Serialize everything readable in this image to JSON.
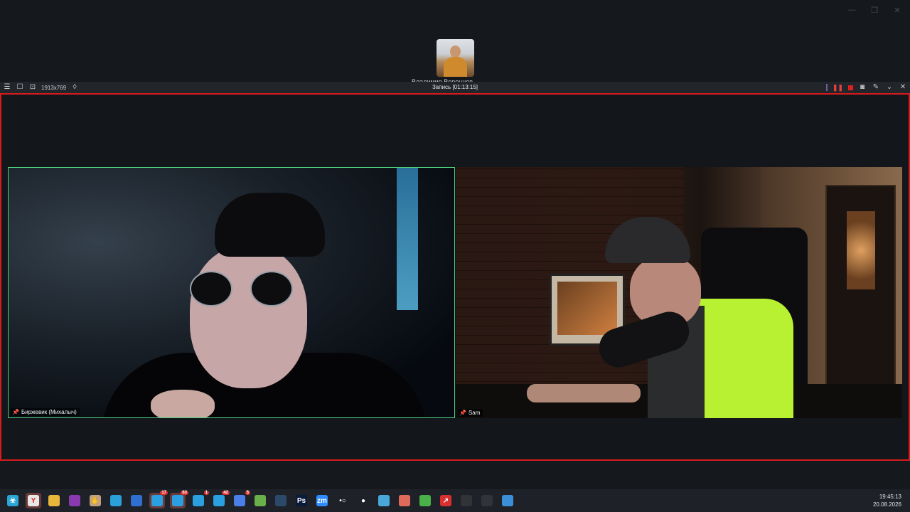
{
  "window": {
    "minimize_icon": "minimize-icon",
    "maximize_icon": "maximize-icon",
    "close_icon": "close-icon"
  },
  "thumbnail": {
    "label": "Владимир Воронцов"
  },
  "toolbar": {
    "resolution": "1913x769",
    "title": "Запись [01:13:15]",
    "icons": [
      "menu-icon",
      "square-icon",
      "zoom-icon",
      "drop-icon",
      "pause-icon",
      "stop-icon",
      "camera-icon",
      "pen-icon",
      "collapse-icon",
      "close-icon"
    ]
  },
  "colors": {
    "accent_border": "#d51b1b",
    "active_speaker": "#4fd17d"
  },
  "participants": [
    {
      "name": "Биржевик (Михалыч)"
    },
    {
      "name": "Sam"
    }
  ],
  "taskbar": {
    "apps": [
      {
        "icon": "biohazard-icon",
        "text": "☣",
        "color": "#2aa6d6"
      },
      {
        "icon": "yandex-browser-icon",
        "text": "Y",
        "color": "#e8e8e8",
        "active": true
      },
      {
        "icon": "folder-icon",
        "text": "",
        "color": "#e9b63c"
      },
      {
        "icon": "winrar-icon",
        "text": "",
        "color": "#8a3ab0"
      },
      {
        "icon": "hand-icon",
        "text": "✋",
        "color": "#c0a080"
      },
      {
        "icon": "app-icon",
        "text": "",
        "color": "#2a9fd8"
      },
      {
        "icon": "globe-icon",
        "text": "",
        "color": "#2e6fd0"
      },
      {
        "icon": "telegram-icon",
        "text": "",
        "color": "#2aa0e0",
        "active": true,
        "badge": "17"
      },
      {
        "icon": "telegram-icon",
        "text": "",
        "color": "#2aa0e0",
        "active": true,
        "badge": "63"
      },
      {
        "icon": "telegram-icon",
        "text": "",
        "color": "#2aa0e0",
        "badge": "1"
      },
      {
        "icon": "telegram-icon",
        "text": "",
        "color": "#2aa0e0",
        "badge": "42"
      },
      {
        "icon": "chrome-icon",
        "text": "",
        "color": "#4a7fe8",
        "badge": "5"
      },
      {
        "icon": "utorrent-icon",
        "text": "",
        "color": "#6ab04a"
      },
      {
        "icon": "steam-icon",
        "text": "",
        "color": "#2b4a6a"
      },
      {
        "icon": "photoshop-icon",
        "text": "Ps",
        "color": "#0a1a3a"
      },
      {
        "icon": "zoom-icon",
        "text": "zm",
        "color": "#2d8cff"
      },
      {
        "icon": "obs-dot-icon",
        "text": "•○",
        "color": "#1e2228"
      },
      {
        "icon": "record-icon",
        "text": "●",
        "color": "#1e2228"
      },
      {
        "icon": "notes-icon",
        "text": "",
        "color": "#4aa8d8"
      },
      {
        "icon": "app-red-icon",
        "text": "",
        "color": "#e06a5a"
      },
      {
        "icon": "excel-icon",
        "text": "",
        "color": "#4ab04a"
      },
      {
        "icon": "arrow-app-icon",
        "text": "↗",
        "color": "#d83030"
      },
      {
        "icon": "obs-icon",
        "text": "",
        "color": "#303438"
      },
      {
        "icon": "obs-icon",
        "text": "",
        "color": "#303438"
      },
      {
        "icon": "photo-app-icon",
        "text": "",
        "color": "#3a8fd8"
      }
    ],
    "time": "19:45:13",
    "date": "20.08.2026"
  }
}
